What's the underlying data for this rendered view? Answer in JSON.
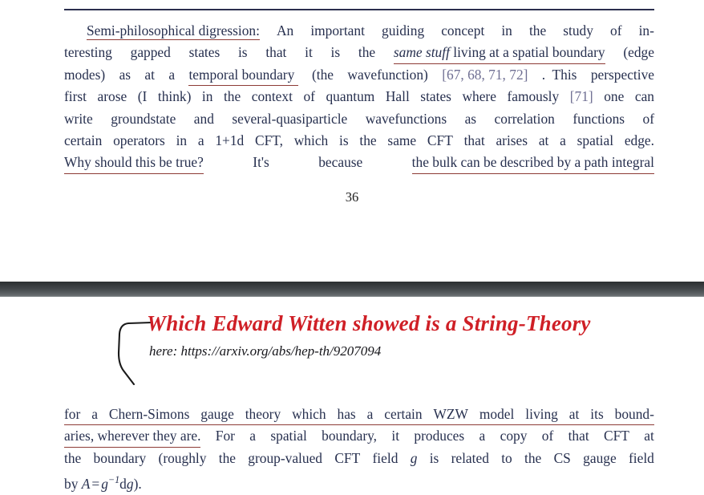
{
  "colors": {
    "text": "#27304f",
    "citation": "#6f6f93",
    "underline": "#8d3b36",
    "annotation_red": "#cf1f26",
    "annotation_black": "#15151a",
    "rule": "#2b2f4e",
    "separator_dark": "#2c2f31",
    "background": "#ffffff"
  },
  "page_top": {
    "rule_above": true,
    "page_number": "36",
    "paragraph_lines": [
      {
        "id": "l1",
        "indent": true,
        "segments": [
          {
            "text": "Semi-philosophical digression:",
            "style": "underline"
          },
          {
            "text": " An important guiding concept in the study of in-",
            "style": "plain"
          }
        ],
        "plain": "Semi-philosophical digression: An important guiding concept in the study of in-"
      },
      {
        "id": "l2",
        "indent": false,
        "segments": [
          {
            "text": "teresting gapped states is that it is the ",
            "style": "plain"
          },
          {
            "text": "same stuff",
            "style": "italic-underline"
          },
          {
            "text": " living at a spatial boundary",
            "style": "underline"
          },
          {
            "text": " (edge",
            "style": "plain"
          }
        ],
        "plain": "teresting gapped states is that it is the same stuff living at a spatial boundary (edge"
      },
      {
        "id": "l3",
        "indent": false,
        "segments": [
          {
            "text": "modes) as at a ",
            "style": "plain"
          },
          {
            "text": "temporal boundary ",
            "style": "underline"
          },
          {
            "text": "(the wavefunction) ",
            "style": "plain"
          },
          {
            "text": "[67, 68, 71, 72]",
            "style": "citation"
          },
          {
            "text": ". This perspective",
            "style": "plain"
          }
        ],
        "plain": "modes) as at a temporal boundary (the wavefunction) [67, 68, 71, 72]. This perspective"
      },
      {
        "id": "l4",
        "indent": false,
        "segments": [
          {
            "text": "first arose (I think) in the context of quantum Hall states where famously ",
            "style": "plain"
          },
          {
            "text": "[71]",
            "style": "citation"
          },
          {
            "text": " one can",
            "style": "plain"
          }
        ],
        "plain": "first arose (I think) in the context of quantum Hall states where famously [71] one can"
      },
      {
        "id": "l5",
        "indent": false,
        "segments": [
          {
            "text": "write groundstate and several-quasiparticle wavefunctions as correlation functions of",
            "style": "plain"
          }
        ],
        "plain": "write groundstate and several-quasiparticle wavefunctions as correlation functions of"
      },
      {
        "id": "l6",
        "indent": false,
        "segments": [
          {
            "text": "certain operators in a 1+1d CFT, which is the same CFT that arises at a spatial edge.",
            "style": "plain"
          }
        ],
        "plain": "certain operators in a 1+1d CFT, which is the same CFT that arises at a spatial edge."
      },
      {
        "id": "l7",
        "indent": false,
        "segments": [
          {
            "text": "Why should this be true?",
            "style": "underline"
          },
          {
            "text": " It's because ",
            "style": "plain"
          },
          {
            "text": "the bulk can be described by a path integral",
            "style": "underline"
          }
        ],
        "plain": "Why should this be true? It's because the bulk can be described by a path integral"
      }
    ]
  },
  "separator": {
    "kind": "page-break-bar"
  },
  "page_bottom": {
    "annotations": {
      "headline": "Which Edward Witten showed is a String-Theory",
      "url_note": "here: https://arxiv.org/abs/hep-th/9207094",
      "brace": "hand-drawn-brace"
    },
    "paragraph_lines": [
      {
        "id": "b1",
        "segments": [
          {
            "text": "for a Chern-Simons gauge theory which has a certain WZW model living at its bound-",
            "style": "underline"
          }
        ],
        "plain": "for a Chern-Simons gauge theory which has a certain WZW model living at its bound-"
      },
      {
        "id": "b2",
        "segments": [
          {
            "text": "aries, wherever they are.",
            "style": "underline"
          },
          {
            "text": " For a spatial boundary, it produces a copy of that CFT at",
            "style": "plain"
          }
        ],
        "plain": "aries, wherever they are. For a spatial boundary, it produces a copy of that CFT at"
      },
      {
        "id": "b3",
        "segments": [
          {
            "text": "the boundary (roughly the group-valued CFT field ",
            "style": "plain"
          },
          {
            "text": "g",
            "style": "italic"
          },
          {
            "text": " is related to the CS gauge field",
            "style": "plain"
          }
        ],
        "plain": "the boundary (roughly the group-valued CFT field g is related to the CS gauge field"
      },
      {
        "id": "b4",
        "segments": [
          {
            "text": "by ",
            "style": "plain"
          },
          {
            "text": "A = g^{-1}dg",
            "style": "math"
          },
          {
            "text": ").",
            "style": "plain"
          }
        ],
        "plain": "by A = g−1dg)."
      }
    ],
    "math_last_line": {
      "prefix": "by ",
      "A": "A",
      "equals": "=",
      "g": "g",
      "exponent": "−1",
      "d": "d",
      "g2": "g",
      "suffix": ")."
    }
  }
}
